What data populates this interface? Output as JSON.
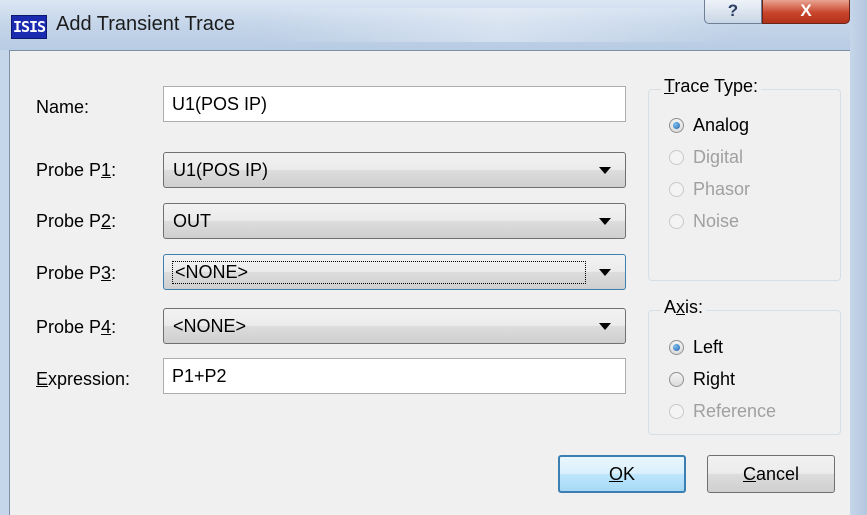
{
  "window": {
    "icon_text": "ISIS",
    "title": "Add Transient Trace",
    "help_glyph": "?",
    "close_glyph": "X"
  },
  "form": {
    "name_label": "Name:",
    "name_value": "U1(POS IP)",
    "probes": [
      {
        "label_pre": "Probe P",
        "label_key": "1",
        "label_post": ":",
        "value": "U1(POS IP)"
      },
      {
        "label_pre": "Probe P",
        "label_key": "2",
        "label_post": ":",
        "value": "OUT"
      },
      {
        "label_pre": "Probe P",
        "label_key": "3",
        "label_post": ":",
        "value": "<NONE>"
      },
      {
        "label_pre": "Probe P",
        "label_key": "4",
        "label_post": ":",
        "value": "<NONE>"
      }
    ],
    "expression_label_key": "E",
    "expression_label_rest": "xpression:",
    "expression_value": "P1+P2"
  },
  "trace_type": {
    "title_key": "T",
    "title_rest": "race Type:",
    "options": [
      {
        "label": "Analog",
        "checked": true,
        "enabled": true
      },
      {
        "label": "Digital",
        "checked": false,
        "enabled": false
      },
      {
        "label": "Phasor",
        "checked": false,
        "enabled": false
      },
      {
        "label": "Noise",
        "checked": false,
        "enabled": false
      }
    ]
  },
  "axis": {
    "title_pre": "A",
    "title_key": "x",
    "title_post": "is:",
    "options": [
      {
        "label": "Left",
        "checked": true,
        "enabled": true
      },
      {
        "label": "Right",
        "checked": false,
        "enabled": true
      },
      {
        "label": "Reference",
        "checked": false,
        "enabled": false
      }
    ]
  },
  "buttons": {
    "ok_key": "O",
    "ok_rest": "K",
    "cancel_key": "C",
    "cancel_rest": "ancel"
  }
}
